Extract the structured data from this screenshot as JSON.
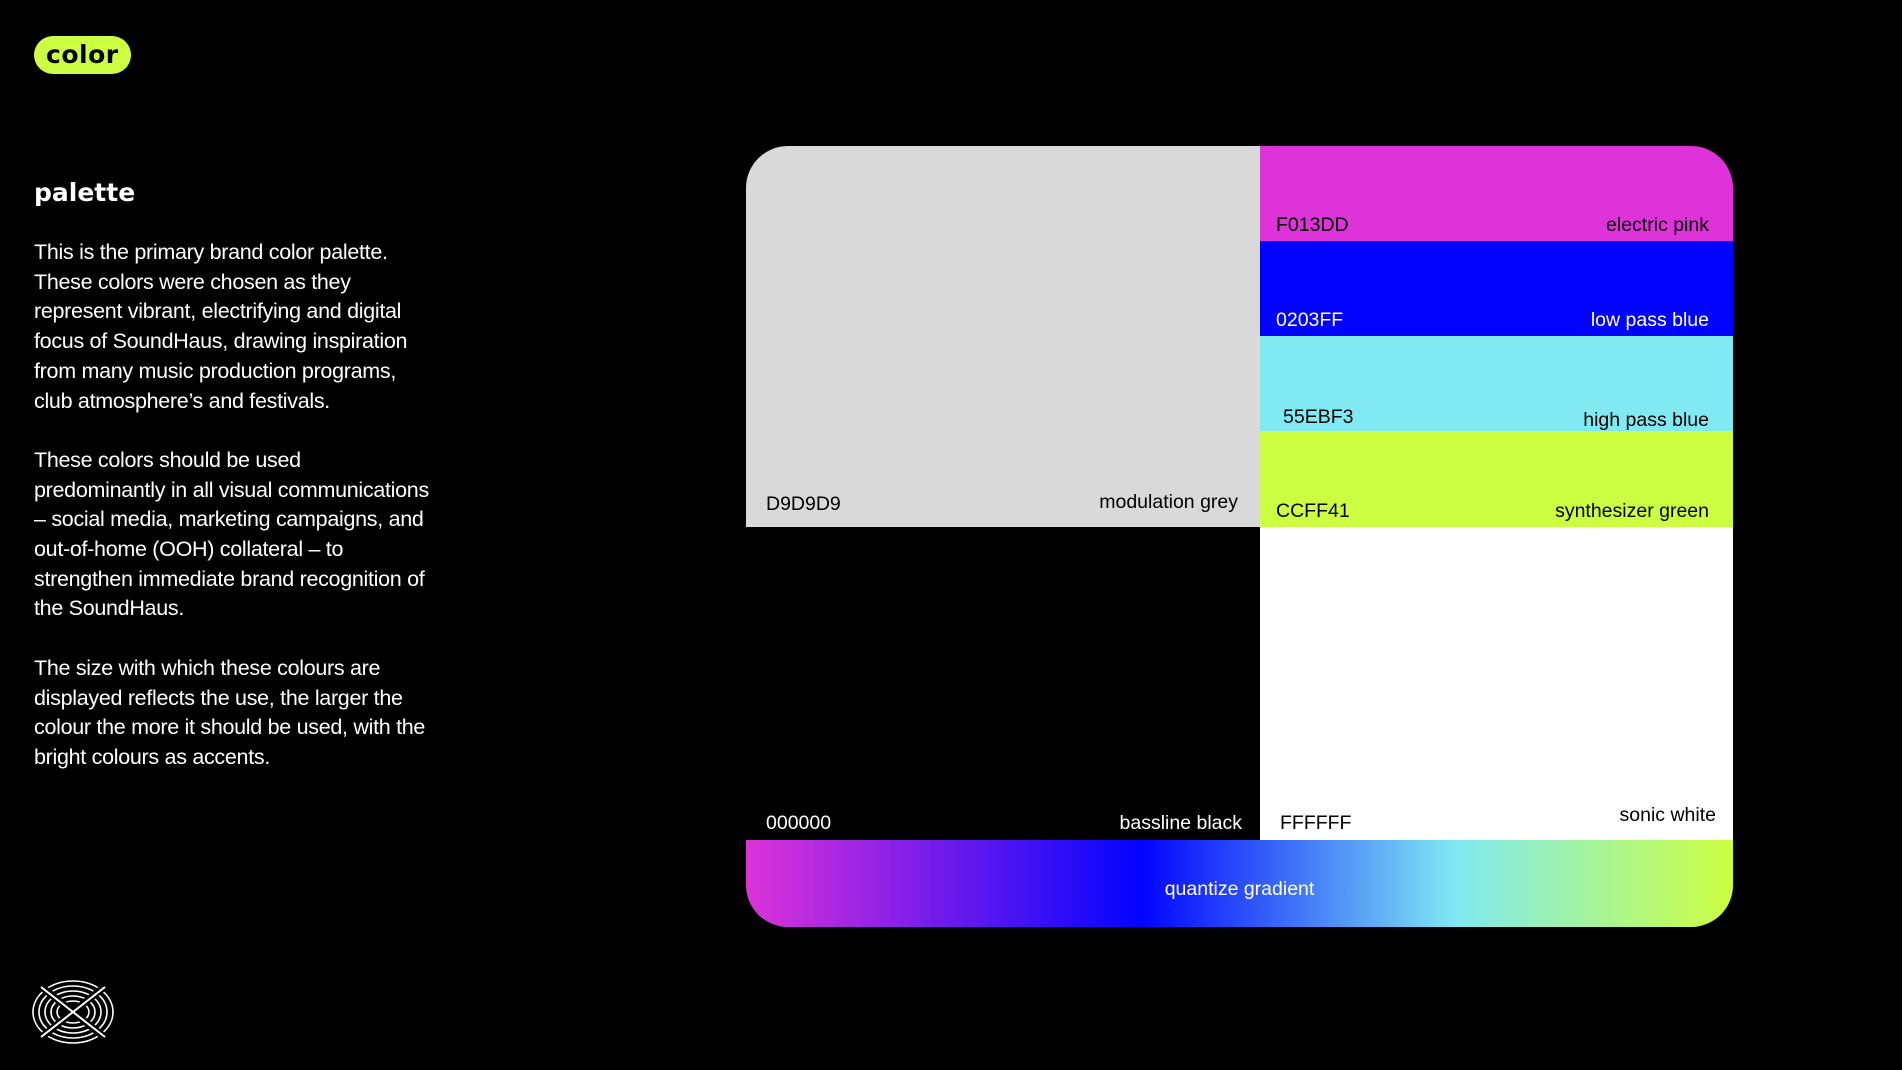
{
  "header": {
    "tag_label": "color"
  },
  "section": {
    "title": "palette",
    "paragraphs": [
      "This is the primary brand color palette. These colors were chosen as they represent vibrant, electrifying and digital focus of SoundHaus, drawing inspiration from many music production programs, club atmosphere’s and festivals.",
      "These colors should be used predominantly in all visual communications – social media, marketing campaigns, and out-of-home (OOH) collateral – to strengthen immediate brand recognition of the SoundHaus.",
      "The size with which these colours are displayed reflects the use, the larger the colour the more it should be used, with the bright colours as accents."
    ]
  },
  "palette": {
    "grey": {
      "hex": "D9D9D9",
      "name": "modulation grey",
      "color": "#D9D9D9",
      "text_color": "#000000"
    },
    "pink": {
      "hex": "F013DD",
      "name": "electric pink",
      "color": "#DD33D8",
      "text_color": "#000000"
    },
    "blue": {
      "hex": "0203FF",
      "name": "low pass blue",
      "color": "#0203FF",
      "text_color": "#ffffff"
    },
    "cyan": {
      "hex": "55EBF3",
      "name": "high pass blue",
      "color": "#80E9F2",
      "text_color": "#000000"
    },
    "green": {
      "hex": "CCFF41",
      "name": "synthesizer green",
      "color": "#CCFF41",
      "text_color": "#000000"
    },
    "black": {
      "hex": "000000",
      "name": "bassline black",
      "color": "#000000",
      "text_color": "#ffffff"
    },
    "white": {
      "hex": "FFFFFF",
      "name": "sonic white",
      "color": "#FFFFFF",
      "text_color": "#000000"
    },
    "gradient": {
      "name": "quantize gradient"
    }
  }
}
